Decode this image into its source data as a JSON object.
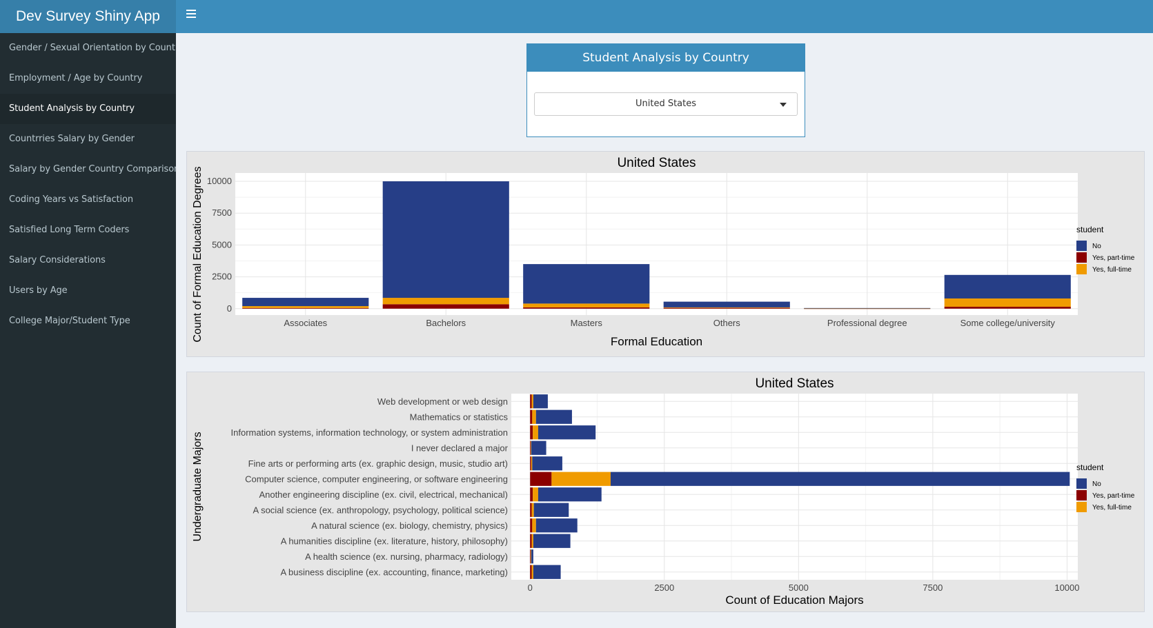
{
  "app": {
    "title": "Dev Survey Shiny App"
  },
  "sidebar": {
    "items": [
      {
        "label": "Gender / Sexual Orientation by Country",
        "active": false
      },
      {
        "label": "Employment / Age by Country",
        "active": false
      },
      {
        "label": "Student Analysis by Country",
        "active": true
      },
      {
        "label": "Countrries Salary by Gender",
        "active": false
      },
      {
        "label": "Salary by Gender Country Comparison",
        "active": false
      },
      {
        "label": "Coding Years vs Satisfaction",
        "active": false
      },
      {
        "label": "Satisfied Long Term Coders",
        "active": false
      },
      {
        "label": "Salary Considerations",
        "active": false
      },
      {
        "label": "Users by Age",
        "active": false
      },
      {
        "label": "College Major/Student Type",
        "active": false
      }
    ]
  },
  "filter_box": {
    "title": "Student Analysis by Country",
    "selected_country": "United States"
  },
  "colors": {
    "No": "#263e87",
    "Yes, part-time": "#8b0000",
    "Yes, full-time": "#f09b00"
  },
  "chart_data": [
    {
      "type": "bar",
      "orientation": "vertical",
      "stacked": true,
      "title": "United States",
      "xlabel": "Formal Education",
      "ylabel": "Count of Formal Education Degrees",
      "ylim": [
        0,
        10000
      ],
      "yticks": [
        0,
        2500,
        5000,
        7500,
        10000
      ],
      "legend_title": "student",
      "legend_position": "right",
      "categories": [
        "Associates",
        "Bachelors",
        "Masters",
        "Others",
        "Professional degree",
        "Some college/university"
      ],
      "series": [
        {
          "name": "Yes, part-time",
          "values": [
            50,
            350,
            100,
            60,
            5,
            150
          ]
        },
        {
          "name": "Yes, full-time",
          "values": [
            150,
            500,
            300,
            40,
            5,
            650
          ]
        },
        {
          "name": "No",
          "values": [
            650,
            9150,
            3100,
            450,
            40,
            1850
          ]
        }
      ]
    },
    {
      "type": "bar",
      "orientation": "horizontal",
      "stacked": true,
      "title": "United States",
      "xlabel": "Count of Education Majors",
      "ylabel": "Undergraduate Majors",
      "xlim": [
        0,
        10000
      ],
      "xticks": [
        0,
        2500,
        5000,
        7500,
        10000
      ],
      "legend_title": "student",
      "legend_position": "right",
      "categories": [
        "Web development or web design",
        "Mathematics or statistics",
        "Information systems, information technology, or system administration",
        "I never declared a major",
        "Fine arts or performing arts (ex. graphic design, music, studio art)",
        "Computer science, computer engineering, or software engineering",
        "Another engineering discipline (ex. civil, electrical, mechanical)",
        "A social science (ex. anthropology, psychology, political science)",
        "A natural science (ex. biology, chemistry, physics)",
        "A humanities discipline (ex. literature, history, philosophy)",
        "A health science (ex. nursing, pharmacy, radiology)",
        "A business discipline (ex. accounting, finance, marketing)"
      ],
      "series": [
        {
          "name": "Yes, part-time",
          "values": [
            30,
            40,
            50,
            10,
            20,
            400,
            50,
            30,
            40,
            30,
            10,
            30
          ]
        },
        {
          "name": "Yes, full-time",
          "values": [
            30,
            70,
            100,
            10,
            20,
            1100,
            100,
            40,
            70,
            30,
            10,
            30
          ]
        },
        {
          "name": "No",
          "values": [
            270,
            670,
            1070,
            280,
            560,
            8550,
            1180,
            650,
            770,
            690,
            40,
            510
          ]
        }
      ]
    }
  ]
}
